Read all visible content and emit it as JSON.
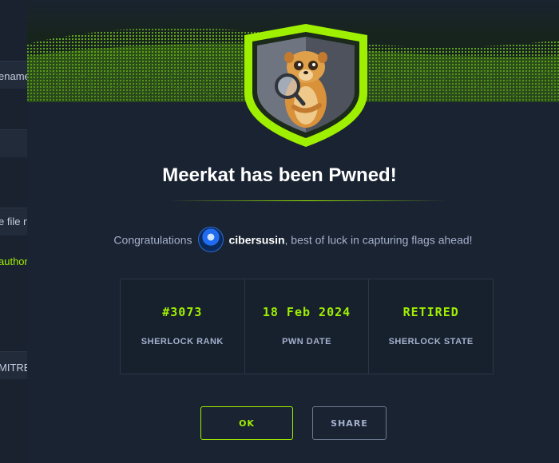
{
  "background": {
    "fragments": [
      "ename",
      "e file n",
      "author",
      "MITRE"
    ]
  },
  "modal": {
    "title": "Meerkat has been Pwned!",
    "congrats_prefix": "Congratulations",
    "username": "cibersusin",
    "congrats_suffix": ", best of luck in capturing flags ahead!",
    "stats": [
      {
        "value": "#3073",
        "label": "SHERLOCK RANK"
      },
      {
        "value": "18 Feb 2024",
        "label": "PWN DATE"
      },
      {
        "value": "RETIRED",
        "label": "SHERLOCK STATE"
      }
    ],
    "ok_label": "OK",
    "share_label": "SHARE"
  },
  "colors": {
    "accent": "#9fef00",
    "background": "#1a2332",
    "text": "#a4b1cd"
  },
  "icons": {
    "badge": "meerkat-sherlock-badge-icon",
    "avatar": "user-avatar-icon"
  }
}
